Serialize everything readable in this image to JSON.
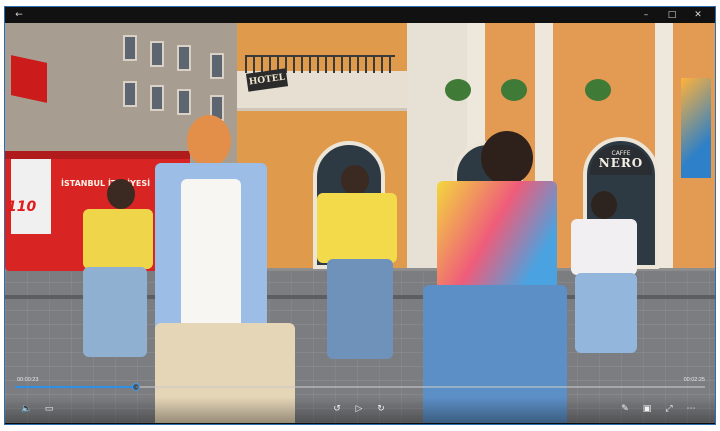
{
  "window": {
    "back_icon": "arrow-left-icon",
    "minimize_glyph": "–",
    "maximize_glyph": "□",
    "close_glyph": "✕"
  },
  "video": {
    "truck_text": "İSTANBUL İTFAİYESİ",
    "truck_number": "110",
    "hotel_sign": "HOTEL",
    "cafe_small": "CAFFE",
    "cafe_big": "NERO"
  },
  "player": {
    "current_time": "00:00:23",
    "total_time": "00:02:25",
    "progress": 0.175,
    "accent_color": "#2f8fe6",
    "controls_left": [
      {
        "name": "volume-icon",
        "glyph": "🔈"
      },
      {
        "name": "subtitles-icon",
        "glyph": "▭"
      }
    ],
    "controls_center": [
      {
        "name": "skip-back-10-icon",
        "glyph": "↺"
      },
      {
        "name": "play-icon",
        "glyph": "▷"
      },
      {
        "name": "skip-forward-30-icon",
        "glyph": "↻"
      }
    ],
    "controls_right": [
      {
        "name": "edit-pen-icon",
        "glyph": "✎"
      },
      {
        "name": "cast-icon",
        "glyph": "▣"
      },
      {
        "name": "fullscreen-icon",
        "glyph": "⤢"
      },
      {
        "name": "more-icon",
        "glyph": "⋯"
      }
    ]
  }
}
